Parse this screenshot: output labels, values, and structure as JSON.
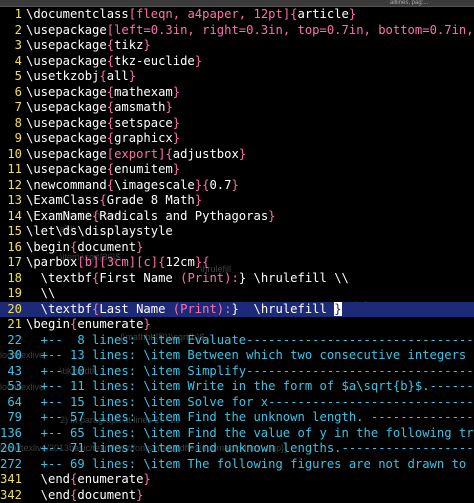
{
  "tabs": [
    "",
    "alllines, pag:..."
  ],
  "background_ghost": [
    "",
    "(Print):} \\hrulefill",
    "e} \\\\",
    "which two consecutive integers do the following square roots lie?",
    "\\item \\sqrt{36}$",
    "\\hrulefill",
    "{\\mathbb{R}}\\sqrt{b}$.",
    "localtexlive",
    "\\tikzwidth",
    "localtexlive",
    "2) in paragraph at lines 20--20",
    "local/texlive/2013basic/texmf-var/fonts/map/pdftex/updmap/pdftex.map}]"
  ],
  "editor": {
    "lines": [
      {
        "num": "1",
        "tokens": [
          [
            "\\documentclass",
            "kw"
          ],
          [
            "[",
            "brace"
          ],
          [
            "fleqn, a4paper, 12pt",
            "opt"
          ],
          [
            "]",
            "brace"
          ],
          [
            "{",
            "brace"
          ],
          [
            "article",
            "arg"
          ],
          [
            "}",
            "brace"
          ]
        ]
      },
      {
        "num": "2",
        "tokens": [
          [
            "\\usepackage",
            "kw"
          ],
          [
            "[",
            "brace"
          ],
          [
            "left=0.3in, right=0.3in, top=0.7in, bottom=0.7in, a4paper",
            "opt"
          ],
          [
            "]",
            "brace"
          ],
          [
            "{",
            "brace"
          ],
          [
            "geom",
            "arg"
          ]
        ]
      },
      {
        "num": "3",
        "tokens": [
          [
            "\\usepackage",
            "kw"
          ],
          [
            "{",
            "brace"
          ],
          [
            "tikz",
            "arg"
          ],
          [
            "}",
            "brace"
          ]
        ]
      },
      {
        "num": "4",
        "tokens": [
          [
            "\\usepackage",
            "kw"
          ],
          [
            "{",
            "brace"
          ],
          [
            "tkz-euclide",
            "arg"
          ],
          [
            "}",
            "brace"
          ]
        ]
      },
      {
        "num": "5",
        "tokens": [
          [
            "\\usetkzobj",
            "kw"
          ],
          [
            "{",
            "brace"
          ],
          [
            "all",
            "arg"
          ],
          [
            "}",
            "brace"
          ]
        ]
      },
      {
        "num": "6",
        "tokens": [
          [
            "\\usepackage",
            "kw"
          ],
          [
            "{",
            "brace"
          ],
          [
            "mathexam",
            "arg"
          ],
          [
            "}",
            "brace"
          ]
        ]
      },
      {
        "num": "7",
        "tokens": [
          [
            "\\usepackage",
            "kw"
          ],
          [
            "{",
            "brace"
          ],
          [
            "amsmath",
            "arg"
          ],
          [
            "}",
            "brace"
          ]
        ]
      },
      {
        "num": "8",
        "tokens": [
          [
            "\\usepackage",
            "kw"
          ],
          [
            "{",
            "brace"
          ],
          [
            "setspace",
            "arg"
          ],
          [
            "}",
            "brace"
          ]
        ]
      },
      {
        "num": "9",
        "tokens": [
          [
            "\\usepackage",
            "kw"
          ],
          [
            "{",
            "brace"
          ],
          [
            "graphicx",
            "arg"
          ],
          [
            "}",
            "brace"
          ]
        ]
      },
      {
        "num": "10",
        "tokens": [
          [
            "\\usepackage",
            "kw"
          ],
          [
            "[",
            "brace"
          ],
          [
            "export",
            "opt"
          ],
          [
            "]",
            "brace"
          ],
          [
            "{",
            "brace"
          ],
          [
            "adjustbox",
            "arg"
          ],
          [
            "}",
            "brace"
          ]
        ]
      },
      {
        "num": "11",
        "tokens": [
          [
            "\\usepackage",
            "kw"
          ],
          [
            "{",
            "brace"
          ],
          [
            "enumitem",
            "arg"
          ],
          [
            "}",
            "brace"
          ]
        ]
      },
      {
        "num": "12",
        "tokens": [
          [
            "\\newcommand",
            "kw"
          ],
          [
            "{",
            "brace"
          ],
          [
            "\\imagescale",
            "arg"
          ],
          [
            "}",
            "brace"
          ],
          [
            "{",
            "brace"
          ],
          [
            "0.7",
            "arg"
          ],
          [
            "}",
            "brace"
          ]
        ]
      },
      {
        "num": "13",
        "tokens": [
          [
            "\\ExamClass",
            "kw"
          ],
          [
            "{",
            "brace"
          ],
          [
            "Grade 8 Math",
            "arg"
          ],
          [
            "}",
            "brace"
          ]
        ]
      },
      {
        "num": "14",
        "tokens": [
          [
            "\\ExamName",
            "kw"
          ],
          [
            "{",
            "brace"
          ],
          [
            "Radicals and Pythagoras",
            "arg"
          ],
          [
            "}",
            "brace"
          ]
        ]
      },
      {
        "num": "15",
        "tokens": [
          [
            "\\let\\ds\\displaystyle",
            "kw"
          ]
        ]
      },
      {
        "num": "16",
        "tokens": [
          [
            "\\begin",
            "kw"
          ],
          [
            "{",
            "brace"
          ],
          [
            "document",
            "arg"
          ],
          [
            "}",
            "brace"
          ]
        ]
      },
      {
        "num": "17",
        "tokens": [
          [
            "\\parbox",
            "kw"
          ],
          [
            "[",
            "brace"
          ],
          [
            "b",
            "opt"
          ],
          [
            "]",
            "brace"
          ],
          [
            "[",
            "brace"
          ],
          [
            "3cm",
            "opt"
          ],
          [
            "]",
            "brace"
          ],
          [
            "[",
            "brace"
          ],
          [
            "c",
            "opt"
          ],
          [
            "]",
            "brace"
          ],
          [
            "{",
            "brace"
          ],
          [
            "12cm",
            "arg"
          ],
          [
            "}",
            "brace"
          ],
          [
            "{",
            "brace"
          ]
        ]
      },
      {
        "num": "18",
        "tokens": [
          [
            "  \\textbf",
            "kw"
          ],
          [
            "{",
            "brace"
          ],
          [
            "First Name ",
            "arg"
          ],
          [
            "(Print):",
            "opt"
          ],
          [
            "} \\hrulefill \\\\",
            "kw"
          ]
        ]
      },
      {
        "num": "19",
        "tokens": [
          [
            "  \\\\",
            "kw"
          ]
        ]
      },
      {
        "num": "20",
        "cur": true,
        "tokens": [
          [
            "  \\textbf",
            "kw"
          ],
          [
            "{",
            "brace"
          ],
          [
            "Last Name ",
            "arg"
          ],
          [
            "(Print):",
            "opt"
          ],
          [
            "}  \\hrulefill ",
            "kw"
          ],
          [
            "}",
            "cursor"
          ]
        ]
      },
      {
        "num": "21",
        "tokens": [
          [
            "\\begin",
            "kw"
          ],
          [
            "{",
            "brace"
          ],
          [
            "enumerate",
            "arg"
          ],
          [
            "}",
            "brace"
          ]
        ]
      },
      {
        "num": "22",
        "fold": true,
        "tokens": [
          [
            "  +--  8 lines: \\item Evaluate-----------------------------------------------------------",
            "fold"
          ]
        ]
      },
      {
        "num": "30",
        "fold": true,
        "tokens": [
          [
            "  +-- 13 lines: \\item Between which two consecutive integers do the follo",
            "fold"
          ]
        ]
      },
      {
        "num": "43",
        "fold": true,
        "tokens": [
          [
            "  +-- 10 lines: \\item Simplify-----------------------------------------------------------",
            "fold"
          ]
        ]
      },
      {
        "num": "53",
        "fold": true,
        "tokens": [
          [
            "  +-- 11 lines: \\item Write in the form of $a\\sqrt{b}$.------------------------------",
            "fold"
          ]
        ]
      },
      {
        "num": "64",
        "fold": true,
        "tokens": [
          [
            "  +-- 15 lines: \\item Solve for x-----------------------------------------------------",
            "fold"
          ]
        ]
      },
      {
        "num": "79",
        "fold": true,
        "tokens": [
          [
            "  +-- 57 lines: \\item Find the unknown length. ----------------------------------------",
            "fold"
          ]
        ]
      },
      {
        "num": "136",
        "fold": true,
        "tokens": [
          [
            "  +-- 65 lines: \\item Find the value of y in the following triangles.-----------------",
            "fold"
          ]
        ]
      },
      {
        "num": "201",
        "fold": true,
        "tokens": [
          [
            "  +-- 71 lines: \\item Find unknown lengths.--------------------------------------------",
            "fold"
          ]
        ]
      },
      {
        "num": "272",
        "fold": true,
        "tokens": [
          [
            "  +-- 69 lines: \\item The following figures are not drawn to scale. Which",
            "fold"
          ]
        ]
      },
      {
        "num": "341",
        "tokens": [
          [
            "  \\end",
            "kw"
          ],
          [
            "{",
            "brace"
          ],
          [
            "enumerate",
            "arg"
          ],
          [
            "}",
            "brace"
          ]
        ]
      },
      {
        "num": "342",
        "tokens": [
          [
            "  \\end",
            "kw"
          ],
          [
            "{",
            "brace"
          ],
          [
            "document",
            "arg"
          ],
          [
            "}",
            "brace"
          ]
        ]
      }
    ]
  },
  "colors": {
    "background": "#000000",
    "line_number": "#f2e04b",
    "bracket_highlight": "#ff6fb0",
    "fold_text": "#38c4e8",
    "cursor_line": "#1d2a78",
    "text": "#ffffff"
  }
}
